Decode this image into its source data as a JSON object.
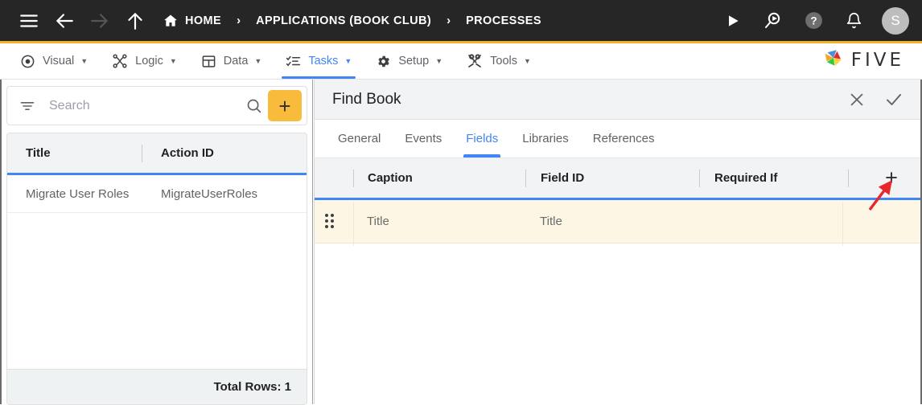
{
  "topbar": {
    "nav_icons": [
      {
        "name": "hamburger-menu-icon",
        "label": "Menu"
      },
      {
        "name": "back-arrow-icon",
        "label": "Back"
      },
      {
        "name": "forward-arrow-icon",
        "label": "Forward"
      },
      {
        "name": "up-arrow-icon",
        "label": "Up"
      }
    ],
    "breadcrumbs": [
      {
        "label": "HOME",
        "icon": "home-icon"
      },
      {
        "label": "APPLICATIONS (BOOK CLUB)",
        "icon": ""
      },
      {
        "label": "PROCESSES",
        "icon": ""
      }
    ],
    "separator": "›",
    "right_icons": [
      {
        "name": "run-play-icon",
        "label": "Run"
      },
      {
        "name": "search-play-icon",
        "label": "Preview"
      },
      {
        "name": "help-circle-icon",
        "label": "Help"
      },
      {
        "name": "bell-notification-icon",
        "label": "Notifications"
      }
    ],
    "avatar_initial": "S",
    "bg_color": "#262626",
    "accent_color": "#F5B323"
  },
  "menubar": {
    "items": [
      {
        "label": "Visual",
        "icon": "eye-icon",
        "caret": "▼",
        "active": false
      },
      {
        "label": "Logic",
        "icon": "logic-nodes-icon",
        "caret": "▼",
        "active": false
      },
      {
        "label": "Data",
        "icon": "table-grid-icon",
        "caret": "▼",
        "active": false
      },
      {
        "label": "Tasks",
        "icon": "checklist-icon",
        "caret": "▼",
        "active": true
      },
      {
        "label": "Setup",
        "icon": "gear-icon",
        "caret": "▼",
        "active": false
      },
      {
        "label": "Tools",
        "icon": "tools-cross-icon",
        "caret": "▼",
        "active": false
      }
    ],
    "brand": "FIVE",
    "active_color": "#4285F4"
  },
  "left_panel": {
    "search": {
      "placeholder": "Search",
      "value": "",
      "filter_icon": "filter-icon",
      "search_icon": "search-icon",
      "add_label": "+",
      "add_color": "#F8BB3C"
    },
    "grid": {
      "columns": [
        "Title",
        "Action ID"
      ],
      "rows": [
        {
          "title": "Migrate User Roles",
          "action_id": "MigrateUserRoles"
        }
      ],
      "footer": "Total Rows: 1"
    }
  },
  "right_panel": {
    "title": "Find Book",
    "close_label": "✕",
    "confirm_label": "✓",
    "tabs": [
      {
        "label": "General",
        "active": false
      },
      {
        "label": "Events",
        "active": false
      },
      {
        "label": "Fields",
        "active": true
      },
      {
        "label": "Libraries",
        "active": false
      },
      {
        "label": "References",
        "active": false
      }
    ],
    "fields_grid": {
      "columns": [
        "Caption",
        "Field ID",
        "Required If"
      ],
      "add_label": "+",
      "rows": [
        {
          "caption": "Title",
          "field_id": "Title",
          "required_if": ""
        }
      ],
      "row_highlight_color": "#FDF6E5"
    }
  },
  "annotation": {
    "arrow_color": "#E8262B",
    "points_at": "fields-grid-add-button"
  }
}
